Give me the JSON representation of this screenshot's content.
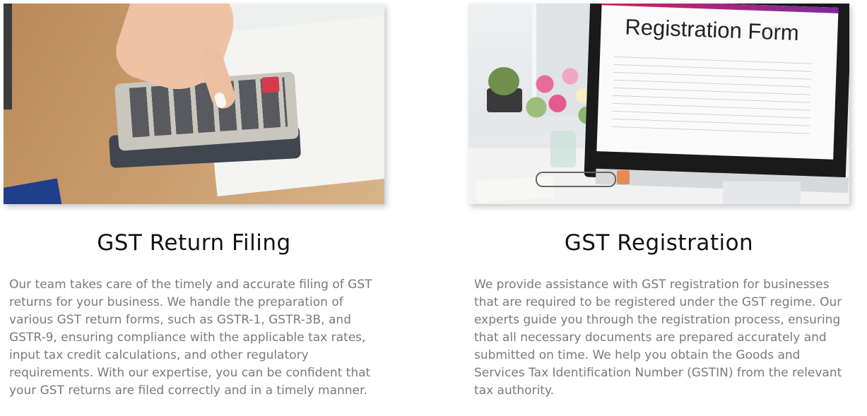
{
  "cards": [
    {
      "title": "GST Return Filing",
      "image_alt": "calculator",
      "description": "Our team takes care of the timely and accurate filing of GST returns for your business. We handle the preparation of various GST return forms, such as GSTR-1, GSTR-3B, and GSTR-9, ensuring compliance with the applicable tax rates, input tax credit calculations, and other regulatory requirements. With our expertise, you can be confident that your GST returns are filed correctly and in a timely manner."
    },
    {
      "title": "GST Registration",
      "image_alt": "registration form on monitor",
      "image_text": "Registration Form",
      "description": "We provide assistance with GST registration for businesses that are required to be registered under the GST regime. Our experts guide you through the registration process, ensuring that all necessary documents are prepared accurately and submitted on time. We help you obtain the Goods and Services Tax Identification Number (GSTIN) from the relevant tax authority."
    }
  ],
  "colors": {
    "title": "#111111",
    "body": "#7a7a7a",
    "background": "#ffffff"
  }
}
